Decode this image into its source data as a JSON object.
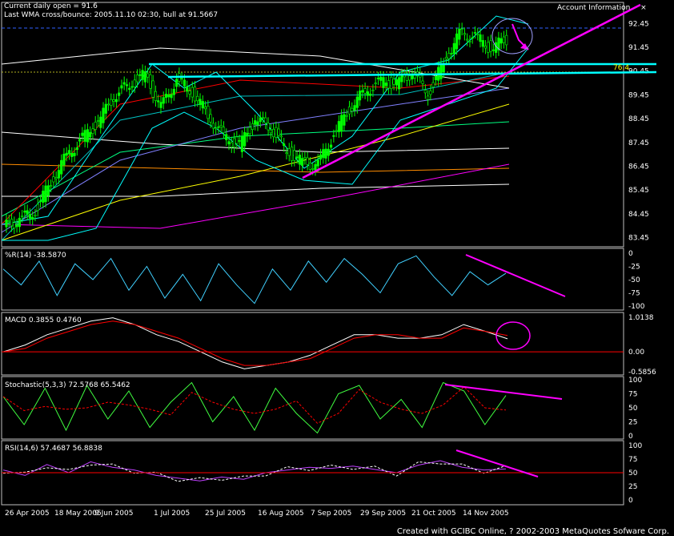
{
  "header": {
    "line1": "Current daily open = 91.6",
    "line2": "Last WMA cross/bounce: 2005.11.10 02:30, bull at 91.5667"
  },
  "account_panel": {
    "label": "Account Information",
    "close": "×"
  },
  "footer": "Created with GCIBC Online, ? 2002-2003 MetaQuotes Sofware Corp.",
  "fib_label": "76.4",
  "colors": {
    "bg": "#000000",
    "candle": "#00ff00",
    "cyan": "#00ffff",
    "magenta": "#ff00ff",
    "red": "#ff0000",
    "white": "#ffffff"
  },
  "chart_data": [
    {
      "type": "line",
      "panel": "price",
      "title": "",
      "y_ticks": [
        92.45,
        91.45,
        90.45,
        89.45,
        88.45,
        87.45,
        86.45,
        85.45,
        84.45,
        83.45
      ],
      "ylim": [
        83.2,
        92.9
      ],
      "current_price_label": "",
      "x_tick_labels": [
        "26 Apr 2005",
        "18 May 2005",
        "9 Jun 2005",
        "1 Jul 2005",
        "25 Jul 2005",
        "16 Aug 2005",
        "7 Sep 2005",
        "29 Sep 2005",
        "21 Oct 2005",
        "14 Nov 2005"
      ],
      "close_series": [
        84.2,
        84.6,
        85.8,
        86.9,
        87.6,
        88.3,
        89.4,
        89.9,
        90.3,
        88.9,
        90.1,
        89.6,
        88.6,
        87.7,
        87.3,
        88.4,
        88.1,
        87.1,
        86.6,
        86.5,
        87.8,
        88.9,
        89.6,
        90.0,
        89.9,
        90.4,
        89.5,
        90.8,
        92.0,
        91.9,
        91.4,
        91.8
      ]
    },
    {
      "type": "line",
      "panel": "williams",
      "title": "%R(14) -38.5870",
      "y_ticks": [
        0,
        -25,
        -50,
        -75,
        -100
      ],
      "ylim": [
        -100,
        0
      ],
      "values": [
        -30,
        -60,
        -15,
        -80,
        -20,
        -50,
        -10,
        -70,
        -25,
        -85,
        -40,
        -90,
        -20,
        -60,
        -95,
        -30,
        -70,
        -15,
        -55,
        -10,
        -40,
        -75,
        -20,
        -5,
        -45,
        -80,
        -35,
        -60,
        -38
      ]
    },
    {
      "type": "line",
      "panel": "macd",
      "title": "MACD 0.3855 0.4760",
      "y_ticks": [
        1.0138,
        0.0,
        -0.5856
      ],
      "ylim": [
        -0.5856,
        1.0138
      ],
      "series": [
        {
          "values": [
            0.0,
            0.2,
            0.5,
            0.7,
            0.9,
            1.0,
            0.8,
            0.5,
            0.3,
            0.0,
            -0.3,
            -0.5,
            -0.4,
            -0.3,
            -0.1,
            0.2,
            0.5,
            0.5,
            0.4,
            0.4,
            0.5,
            0.8,
            0.6,
            0.38
          ]
        },
        {
          "values": [
            0.0,
            0.1,
            0.4,
            0.6,
            0.8,
            0.9,
            0.8,
            0.6,
            0.4,
            0.1,
            -0.2,
            -0.4,
            -0.4,
            -0.3,
            -0.2,
            0.1,
            0.4,
            0.5,
            0.5,
            0.4,
            0.4,
            0.7,
            0.6,
            0.48
          ]
        }
      ]
    },
    {
      "type": "line",
      "panel": "stochastic",
      "title": "Stochastic(5,3,3) 72.5768 65.5462",
      "y_ticks": [
        100,
        75,
        50,
        25,
        0
      ],
      "ylim": [
        0,
        100
      ],
      "values": [
        70,
        20,
        85,
        10,
        90,
        30,
        80,
        15,
        60,
        95,
        25,
        70,
        10,
        85,
        40,
        5,
        75,
        90,
        30,
        65,
        15,
        95,
        80,
        20,
        72
      ]
    },
    {
      "type": "line",
      "panel": "rsi",
      "title": "RSI(14,6) 57.4687 56.8838",
      "y_ticks": [
        100,
        75,
        50,
        25,
        0
      ],
      "ylim": [
        0,
        100
      ],
      "values": [
        55,
        45,
        65,
        50,
        70,
        60,
        55,
        45,
        40,
        35,
        42,
        38,
        50,
        55,
        60,
        58,
        62,
        56,
        50,
        64,
        72,
        60,
        55,
        57
      ]
    }
  ]
}
